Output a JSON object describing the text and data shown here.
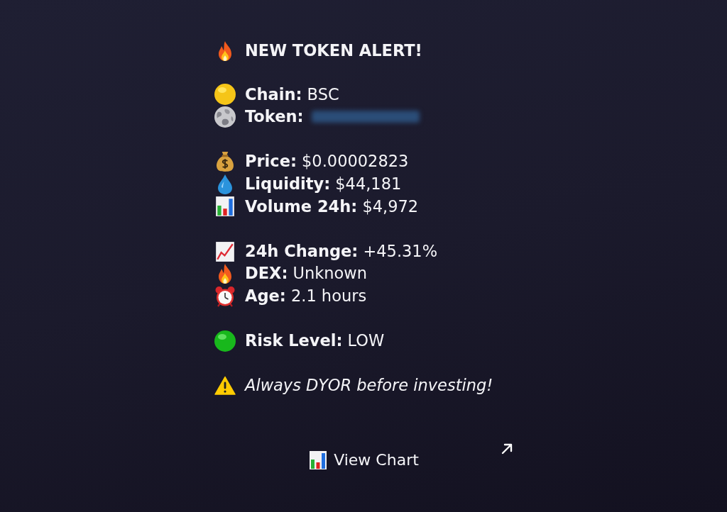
{
  "message": {
    "title": "NEW TOKEN ALERT!",
    "groups": [
      {
        "lines": [
          {
            "kind": "field",
            "label": "Chain:",
            "value": "BSC"
          },
          {
            "kind": "redacted",
            "label": "Token:"
          }
        ]
      },
      {
        "lines": [
          {
            "kind": "field",
            "label": "Price:",
            "value": "$0.00002823"
          },
          {
            "kind": "field",
            "label": "Liquidity:",
            "value": "$44,181"
          },
          {
            "kind": "field",
            "label": "Volume 24h:",
            "value": "$4,972"
          }
        ]
      },
      {
        "lines": [
          {
            "kind": "field",
            "label": "24h Change:",
            "value": "+45.31%"
          },
          {
            "kind": "field",
            "label": "DEX:",
            "value": "Unknown"
          },
          {
            "kind": "field",
            "label": "Age:",
            "value": "2.1 hours"
          }
        ]
      },
      {
        "lines": [
          {
            "kind": "field",
            "label": "Risk Level:",
            "value": "LOW"
          }
        ]
      }
    ],
    "disclaimer": "Always DYOR before investing!"
  },
  "buttons": [
    {
      "label": "View Chart"
    }
  ]
}
